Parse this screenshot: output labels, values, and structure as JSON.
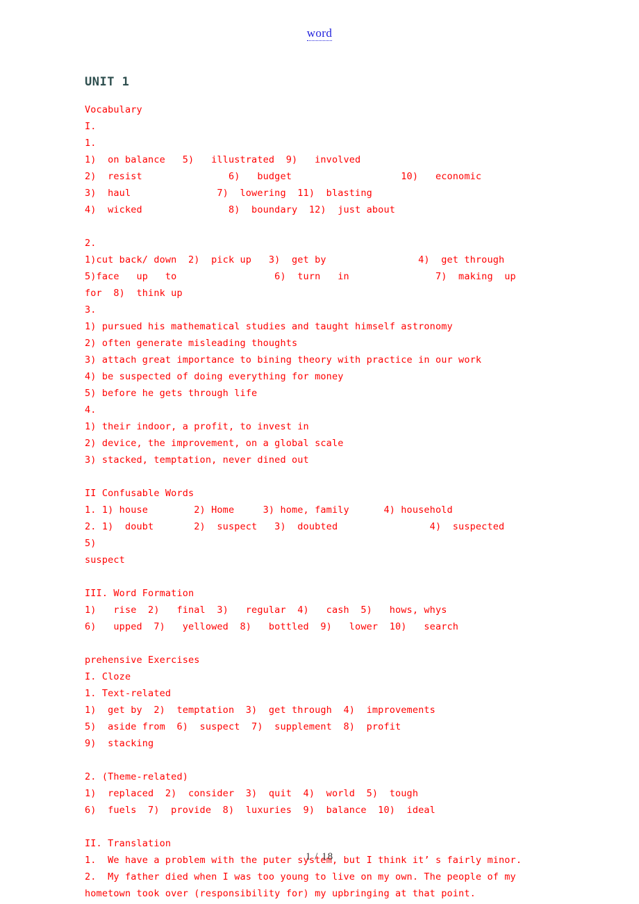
{
  "header": {
    "link_label": "word"
  },
  "footer": {
    "page_indicator": "1 / 18"
  },
  "colors": {
    "body_text": "#FF0000",
    "heading": "#2F4F4F",
    "link": "#2323DC",
    "page_number": "#333333",
    "background": "#FFFFFF"
  },
  "document": {
    "unit_title": "UNIT 1",
    "lines": [
      {
        "id": "l01",
        "text": "Vocabulary"
      },
      {
        "id": "l02",
        "text": "I."
      },
      {
        "id": "l03",
        "text": "1."
      },
      {
        "id": "l04",
        "text": "1)  on balance   5)   illustrated  9)   involved"
      },
      {
        "id": "l05",
        "text": "2)  resist               6)   budget                   10)   economic"
      },
      {
        "id": "l06",
        "text": "3)  haul               7)  lowering  11)  blasting"
      },
      {
        "id": "l07",
        "text": "4)  wicked               8)  boundary  12)  just about"
      },
      {
        "id": "l08",
        "text": "",
        "blank": true
      },
      {
        "id": "l09",
        "text": "2."
      },
      {
        "id": "l10",
        "text": "1)cut back/ down  2)  pick up   3)  get by                4)  get through"
      },
      {
        "id": "l11",
        "text": "5)face   up   to                 6)  turn   in               7)  making  up"
      },
      {
        "id": "l12",
        "text": "for  8)  think up"
      },
      {
        "id": "l13",
        "text": "3."
      },
      {
        "id": "l14",
        "text": "1) pursued his mathematical studies and taught himself astronomy"
      },
      {
        "id": "l15",
        "text": "2) often generate misleading thoughts"
      },
      {
        "id": "l16",
        "text": "3) attach great importance to bining theory with practice in our work"
      },
      {
        "id": "l17",
        "text": "4) be suspected of doing everything for money"
      },
      {
        "id": "l18",
        "text": "5) before he gets through life"
      },
      {
        "id": "l19",
        "text": "4."
      },
      {
        "id": "l20",
        "text": "1) their indoor, a profit, to invest in"
      },
      {
        "id": "l21",
        "text": "2) device, the improvement, on a global scale"
      },
      {
        "id": "l22",
        "text": "3) stacked, temptation, never dined out"
      },
      {
        "id": "l23",
        "text": "",
        "blank": true
      },
      {
        "id": "l24",
        "text": "II Confusable Words"
      },
      {
        "id": "l25",
        "text": "1. 1) house        2) Home     3) home, family      4) household"
      },
      {
        "id": "l26",
        "text": "2. 1)  doubt       2)  suspect   3)  doubted                4)  suspected        5)"
      },
      {
        "id": "l27",
        "text": "suspect"
      },
      {
        "id": "l28",
        "text": "",
        "blank": true
      },
      {
        "id": "l29",
        "text": "III. Word Formation"
      },
      {
        "id": "l30",
        "text": "1)   rise  2)   final  3)   regular  4)   cash  5)   hows, whys"
      },
      {
        "id": "l31",
        "text": "6)   upped  7)   yellowed  8)   bottled  9)   lower  10)   search"
      },
      {
        "id": "l32",
        "text": "",
        "blank": true
      },
      {
        "id": "l33",
        "text": "prehensive Exercises"
      },
      {
        "id": "l34",
        "text": "I. Cloze"
      },
      {
        "id": "l35",
        "text": "1. Text-related"
      },
      {
        "id": "l36",
        "text": "1)  get by  2)  temptation  3)  get through  4)  improvements"
      },
      {
        "id": "l37",
        "text": "5)  aside from  6)  suspect  7)  supplement  8)  profit"
      },
      {
        "id": "l38",
        "text": "9)  stacking"
      },
      {
        "id": "l39",
        "text": "",
        "blank": true
      },
      {
        "id": "l40",
        "text": "2. (Theme-related)"
      },
      {
        "id": "l41",
        "text": "1)  replaced  2)  consider  3)  quit  4)  world  5)  tough"
      },
      {
        "id": "l42",
        "text": "6)  fuels  7)  provide  8)  luxuries  9)  balance  10)  ideal"
      },
      {
        "id": "l43",
        "text": "",
        "blank": true
      },
      {
        "id": "l44",
        "text": "II. Translation"
      },
      {
        "id": "l45",
        "text": "1.  We have a problem with the puter system, but I think it’ s fairly minor."
      },
      {
        "id": "l46",
        "text": "2.  My father died when I was too young to live on my own. The people of my"
      },
      {
        "id": "l47",
        "text": "hometown took over (responsibility for) my upbringing at that point."
      }
    ]
  }
}
